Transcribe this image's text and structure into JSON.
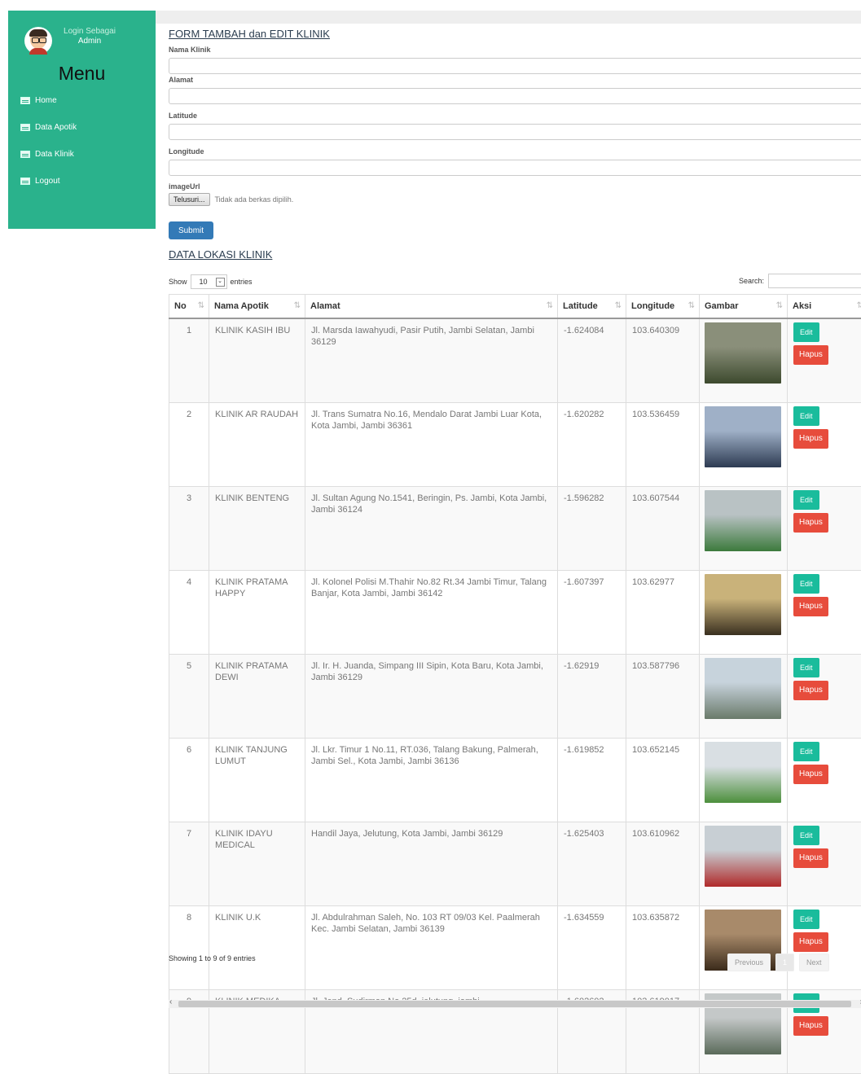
{
  "sidebar": {
    "login_line1": "Login Sebagai",
    "login_line2": "Admin",
    "menu_title": "Menu",
    "items": [
      {
        "label": "Home",
        "icon": "table-icon"
      },
      {
        "label": "Data Apotik",
        "icon": "table-icon"
      },
      {
        "label": "Data Klinik",
        "icon": "table-icon"
      },
      {
        "label": "Logout",
        "icon": "table-icon"
      }
    ],
    "bg_color": "#2ab28c"
  },
  "form": {
    "title": "FORM TAMBAH dan EDIT KLINIK",
    "nama_label": "Nama Klinik",
    "alamat_label": "Alamat",
    "latitude_label": "Latitude",
    "longitude_label": "Longitude",
    "image_label": "imageUrl",
    "file_button": "Telusuri...",
    "file_status": "Tidak ada berkas dipilih.",
    "submit_label": "Submit"
  },
  "table_section": {
    "title": "DATA LOKASI KLINIK",
    "show_label": "Show",
    "entries_value": "10",
    "entries_label": "entries",
    "search_label": "Search:",
    "columns": [
      "No",
      "Nama Apotik",
      "Alamat",
      "Latitude",
      "Longitude",
      "Gambar",
      "Aksi"
    ],
    "edit_label": "Edit",
    "delete_label": "Hapus",
    "rows": [
      {
        "no": "1",
        "nama": "KLINIK KASIH IBU",
        "alamat": "Jl. Marsda Iawahyudi, Pasir Putih, Jambi Selatan, Jambi 36129",
        "lat": "-1.624084",
        "lng": "103.640309"
      },
      {
        "no": "2",
        "nama": "KLINIK AR RAUDAH",
        "alamat": "Jl. Trans Sumatra No.16, Mendalo Darat Jambi Luar Kota, Kota Jambi, Jambi 36361",
        "lat": "-1.620282",
        "lng": "103.536459"
      },
      {
        "no": "3",
        "nama": "KLINIK BENTENG",
        "alamat": "Jl. Sultan Agung No.1541, Beringin, Ps. Jambi, Kota Jambi, Jambi 36124",
        "lat": "-1.596282",
        "lng": "103.607544"
      },
      {
        "no": "4",
        "nama": "KLINIK PRATAMA HAPPY",
        "alamat": "Jl. Kolonel Polisi M.Thahir No.82 Rt.34 Jambi Timur, Talang Banjar, Kota Jambi, Jambi 36142",
        "lat": "-1.607397",
        "lng": "103.62977"
      },
      {
        "no": "5",
        "nama": "KLINIK PRATAMA DEWI",
        "alamat": "Jl. Ir. H. Juanda, Simpang III Sipin, Kota Baru, Kota Jambi, Jambi 36129",
        "lat": "-1.62919",
        "lng": "103.587796"
      },
      {
        "no": "6",
        "nama": "KLINIK TANJUNG LUMUT",
        "alamat": "Jl. Lkr. Timur 1 No.11, RT.036, Talang Bakung, Palmerah, Jambi Sel., Kota Jambi, Jambi 36136",
        "lat": "-1.619852",
        "lng": "103.652145"
      },
      {
        "no": "7",
        "nama": "KLINIK IDAYU MEDICAL",
        "alamat": "Handil Jaya, Jelutung, Kota Jambi, Jambi 36129",
        "lat": "-1.625403",
        "lng": "103.610962"
      },
      {
        "no": "8",
        "nama": "KLINIK U.K",
        "alamat": "Jl. Abdulrahman Saleh, No. 103 RT 09/03 Kel. Paalmerah Kec. Jambi Selatan, Jambi 36139",
        "lat": "-1.634559",
        "lng": "103.635872"
      },
      {
        "no": "9",
        "nama": "KLINIK MEDIKA",
        "alamat": "Jl. Jend. Sudirman No.25d, jelutung, jambi",
        "lat": "-1.602602",
        "lng": "103.619017"
      }
    ],
    "photo_colors": [
      [
        "#8a8f7a",
        "#3d4a2e"
      ],
      [
        "#9fb0c7",
        "#2d3b52"
      ],
      [
        "#b9c2c4",
        "#3c7a3c"
      ],
      [
        "#c9b27a",
        "#3a3020"
      ],
      [
        "#c7d3dc",
        "#6a7a6a"
      ],
      [
        "#d9dfe3",
        "#4c8f3c"
      ],
      [
        "#c8cfd4",
        "#b02a2a"
      ],
      [
        "#a88a6a",
        "#3a2a1a"
      ],
      [
        "#c4c8c8",
        "#5a6a5a"
      ]
    ],
    "info": "Showing 1 to 9 of 9 entries",
    "prev_label": "Previous",
    "page_num": "1",
    "next_label": "Next",
    "edit_color": "#1abc9c",
    "delete_color": "#e74c3c"
  }
}
